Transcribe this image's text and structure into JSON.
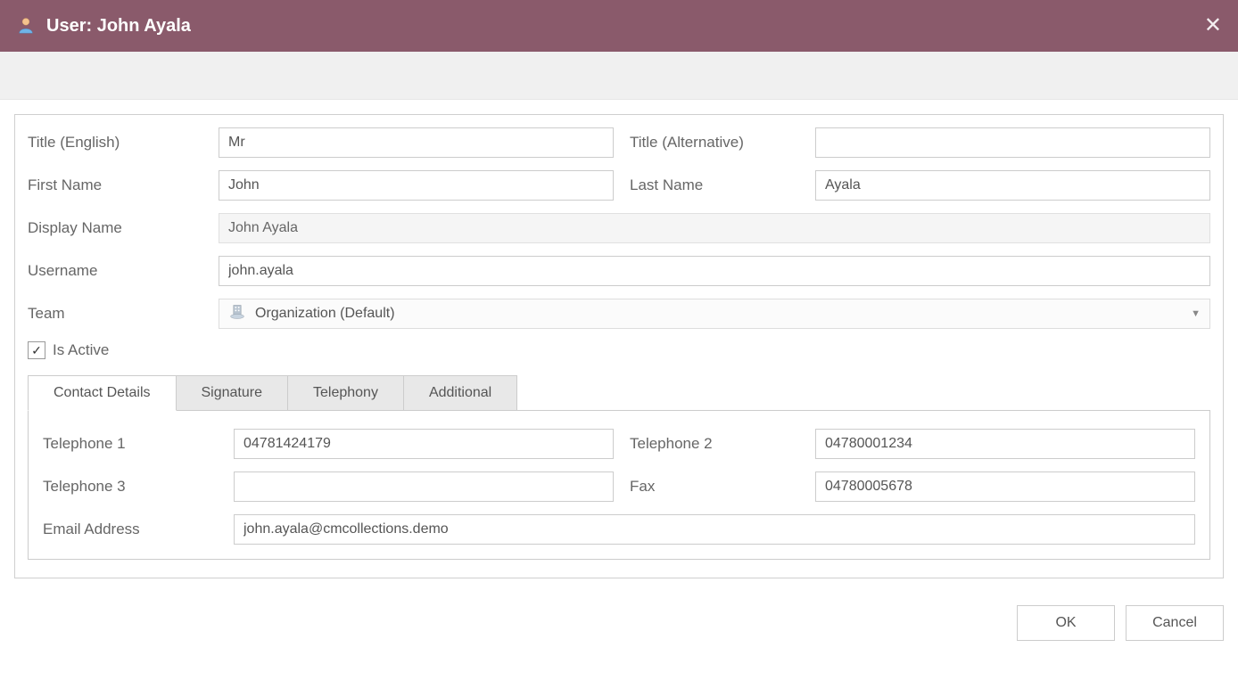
{
  "window": {
    "title": "User: John Ayala"
  },
  "form": {
    "labels": {
      "title_en": "Title (English)",
      "title_alt": "Title (Alternative)",
      "first_name": "First Name",
      "last_name": "Last Name",
      "display_name": "Display Name",
      "username": "Username",
      "team": "Team",
      "is_active": "Is Active"
    },
    "values": {
      "title_en": "Mr",
      "title_alt": "",
      "first_name": "John",
      "last_name": "Ayala",
      "display_name": "John Ayala",
      "username": "john.ayala",
      "team": "Organization (Default)"
    }
  },
  "tabs": {
    "contact_details": "Contact Details",
    "signature": "Signature",
    "telephony": "Telephony",
    "additional": "Additional"
  },
  "contact": {
    "labels": {
      "tel1": "Telephone 1",
      "tel2": "Telephone 2",
      "tel3": "Telephone 3",
      "fax": "Fax",
      "email": "Email Address"
    },
    "values": {
      "tel1": "04781424179",
      "tel2": "04780001234",
      "tel3": "",
      "fax": "04780005678",
      "email": "john.ayala@cmcollections.demo"
    }
  },
  "buttons": {
    "ok": "OK",
    "cancel": "Cancel"
  }
}
